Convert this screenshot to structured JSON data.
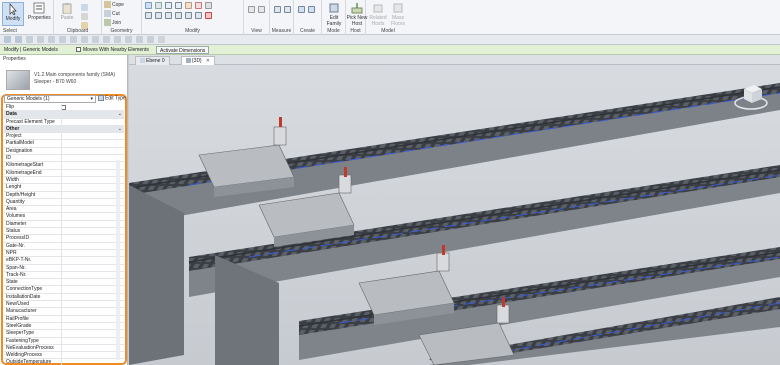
{
  "ribbon": {
    "select_label": "Modify",
    "select_dropdown": "Select",
    "properties_label": "Properties",
    "paste_label": "Paste",
    "clipboard_group": "Clipboard",
    "cope_label": "Cope",
    "cut_label": "Cut",
    "join_label": "Join",
    "geometry_group": "Geometry",
    "modify_group": "Modify",
    "view_group": "View",
    "measure_group": "Measure",
    "create_group": "Create",
    "edit_family_label": "Edit Family",
    "mode_group": "Mode",
    "pick_new_host_label": "Pick New Host",
    "host_group": "Host",
    "related_hosts_label": "Related Hosts",
    "mass_floors_label": "Mass Floors",
    "model_group": "Model"
  },
  "context": {
    "title": "Modify | Generic Models",
    "moves_label": "Moves With Nearby Elements",
    "activate_label": "Activate Dimensions"
  },
  "properties": {
    "title": "Properties",
    "type_name_line1": "V1.2.Main components family (SMA)",
    "type_name_line2": "Sleeper - B70 W60",
    "selector": "Generic Models (1)",
    "edit_type": "Edit Type",
    "rows": [
      {
        "label": "Flip",
        "type": "check"
      },
      {
        "label": "Data",
        "type": "section"
      },
      {
        "label": "Precast Element Type",
        "type": "row"
      },
      {
        "label": "Other",
        "type": "section"
      },
      {
        "label": "Project",
        "type": "row"
      },
      {
        "label": "PartialModel",
        "type": "row"
      },
      {
        "label": "Designation",
        "type": "row"
      },
      {
        "label": "ID",
        "type": "row"
      },
      {
        "label": "KilometrageStart",
        "type": "row"
      },
      {
        "label": "KilometrageEnd",
        "type": "row"
      },
      {
        "label": "Width",
        "type": "row"
      },
      {
        "label": "Lenght",
        "type": "row"
      },
      {
        "label": "Depth/Height",
        "type": "row"
      },
      {
        "label": "Quantity",
        "type": "row"
      },
      {
        "label": "Area",
        "type": "row"
      },
      {
        "label": "Volumes",
        "type": "row"
      },
      {
        "label": "Diameter",
        "type": "row"
      },
      {
        "label": "Status",
        "type": "row"
      },
      {
        "label": "ProcessID",
        "type": "row"
      },
      {
        "label": "Gate-Nr.",
        "type": "row"
      },
      {
        "label": "NPR",
        "type": "row"
      },
      {
        "label": "eBKP-T-Nr.",
        "type": "row"
      },
      {
        "label": "Span-Nr.",
        "type": "row"
      },
      {
        "label": "Track-Nr.",
        "type": "row"
      },
      {
        "label": "State",
        "type": "row"
      },
      {
        "label": "ConnectionType",
        "type": "row"
      },
      {
        "label": "InstallationDate",
        "type": "row"
      },
      {
        "label": "New/Used",
        "type": "row"
      },
      {
        "label": "Manucacturer",
        "type": "row"
      },
      {
        "label": "RailProfile",
        "type": "row"
      },
      {
        "label": "SteelGrade",
        "type": "row"
      },
      {
        "label": "SleeperType",
        "type": "row"
      },
      {
        "label": "FasteningType",
        "type": "row"
      },
      {
        "label": "NeEvaluationProcess",
        "type": "row"
      },
      {
        "label": "WeldingProcess",
        "type": "row"
      },
      {
        "label": "OutsideTemperature",
        "type": "row"
      }
    ]
  },
  "tabs": [
    {
      "label": "Ebene 0",
      "active": false
    },
    {
      "label": "{3D}",
      "active": true
    }
  ],
  "colors": {
    "accent_orange": "#f08a24",
    "context_green": "#e2f1d6",
    "rail_blue": "#3b5bd0"
  }
}
